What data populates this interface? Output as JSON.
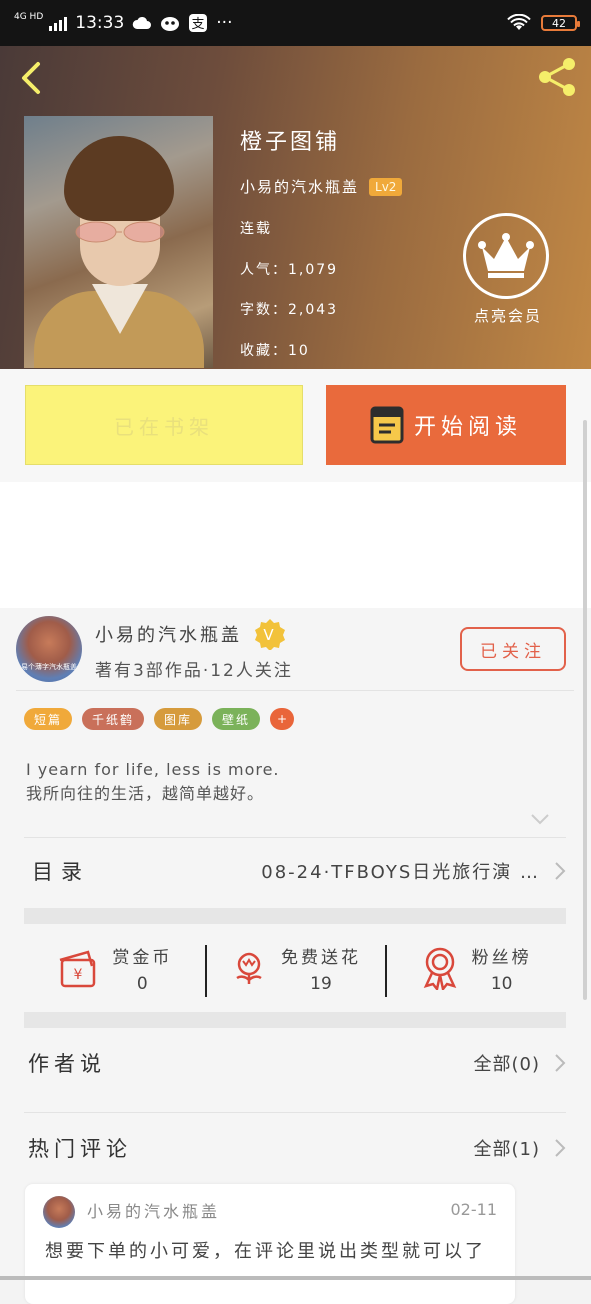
{
  "status_bar": {
    "network": "4G HD",
    "time": "13:33",
    "more": "···",
    "battery": "42"
  },
  "book": {
    "title": "橙子图铺",
    "author": "小易的汽水瓶盖",
    "level": "Lv2",
    "status": "连载",
    "popularity_label": "人气：",
    "popularity": "1,079",
    "wordcount_label": "字数：",
    "wordcount": "2,043",
    "favorites_label": "收藏：",
    "favorites": "10"
  },
  "vip": {
    "label": "点亮会员"
  },
  "actions": {
    "shelf_label": "已在书架",
    "read_label": "开始阅读"
  },
  "author_card": {
    "name": "小易的汽水瓶盖",
    "stats": "著有3部作品·12人关注",
    "follow_label": "已关注",
    "avatar_caption": "易个薄字汽水瓶盖"
  },
  "tags": [
    {
      "label": "短篇",
      "color": "#f0a93a"
    },
    {
      "label": "千纸鹤",
      "color": "#c9705a"
    },
    {
      "label": "图库",
      "color": "#d69b3c"
    },
    {
      "label": "壁纸",
      "color": "#7bb25a"
    },
    {
      "label": "+",
      "color": "#e9653a"
    }
  ],
  "intro": {
    "line1": "I yearn for life, less is more.",
    "line2": "我所向往的生活，越简单越好。"
  },
  "toc": {
    "label": "目录",
    "latest": "08-24·TFBOYS日光旅行演 …"
  },
  "stats": [
    {
      "label": "赏金币",
      "value": "0"
    },
    {
      "label": "免费送花",
      "value": "19"
    },
    {
      "label": "粉丝榜",
      "value": "10"
    }
  ],
  "author_says": {
    "label": "作者说",
    "all": "全部(0)"
  },
  "hot_comments": {
    "label": "热门评论",
    "all": "全部(1)"
  },
  "comment": {
    "user": "小易的汽水瓶盖",
    "date": "02-11",
    "text": "想要下单的小可爱，在评论里说出类型就可以了"
  },
  "colors": {
    "accent": "#e96a3c",
    "shelf": "#fbf37a",
    "follow": "#e2614a",
    "icon_red": "#d9483b"
  }
}
